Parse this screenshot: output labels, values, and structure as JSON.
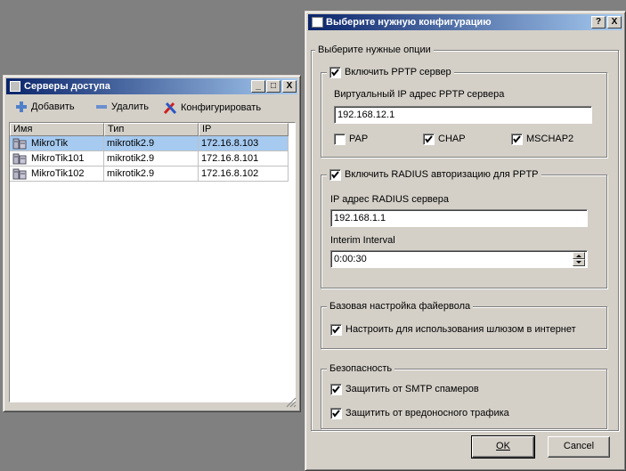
{
  "servers_window": {
    "title": "Серверы доступа",
    "toolbar": {
      "add": "Добавить",
      "remove": "Удалить",
      "configure": "Конфигурировать"
    },
    "columns": [
      "Имя",
      "Тип",
      "IP"
    ],
    "rows": [
      {
        "name": "MikroTik",
        "type": "mikrotik2.9",
        "ip": "172.16.8.103",
        "selected": true
      },
      {
        "name": "MikroTik101",
        "type": "mikrotik2.9",
        "ip": "172.16.8.101",
        "selected": false
      },
      {
        "name": "MikroTik102",
        "type": "mikrotik2.9",
        "ip": "172.16.8.102",
        "selected": false
      }
    ]
  },
  "config_dialog": {
    "title": "Выберите нужную конфигурацию",
    "title_buttons": {
      "help": "?",
      "close": "X"
    },
    "outer_group": "Выберите нужные опции",
    "pptp": {
      "legend": "Включить PPTP сервер",
      "checked": true,
      "virtual_ip_label": "Виртуальный IP адрес PPTP сервера",
      "virtual_ip": "192.168.12.1",
      "pap": {
        "label": "PAP",
        "checked": false
      },
      "chap": {
        "label": "CHAP",
        "checked": true
      },
      "mschap2": {
        "label": "MSCHAP2",
        "checked": true
      }
    },
    "radius": {
      "legend": "Включить RADIUS авторизацию для PPTP",
      "checked": true,
      "server_label": "IP адрес RADIUS сервера",
      "server_ip": "192.168.1.1",
      "interim_label": "Interim Interval",
      "interim_value": "0:00:30"
    },
    "firewall": {
      "legend": "Базовая настройка файервола",
      "gateway": {
        "label": "Настроить для использования шлюзом в интернет",
        "checked": true
      }
    },
    "security": {
      "legend": "Безопасность",
      "smtp": {
        "label": "Защитить от SMTP спамеров",
        "checked": true
      },
      "malicious": {
        "label": "Защитить от вредоносного трафика",
        "checked": true
      }
    },
    "buttons": {
      "ok": "OK",
      "cancel": "Cancel"
    }
  },
  "colors": {
    "title_gradient_start": "#0a246a",
    "title_gradient_end": "#a6caf0",
    "selection": "#a6caf0",
    "desktop": "#808080",
    "face": "#d4d0c8"
  }
}
